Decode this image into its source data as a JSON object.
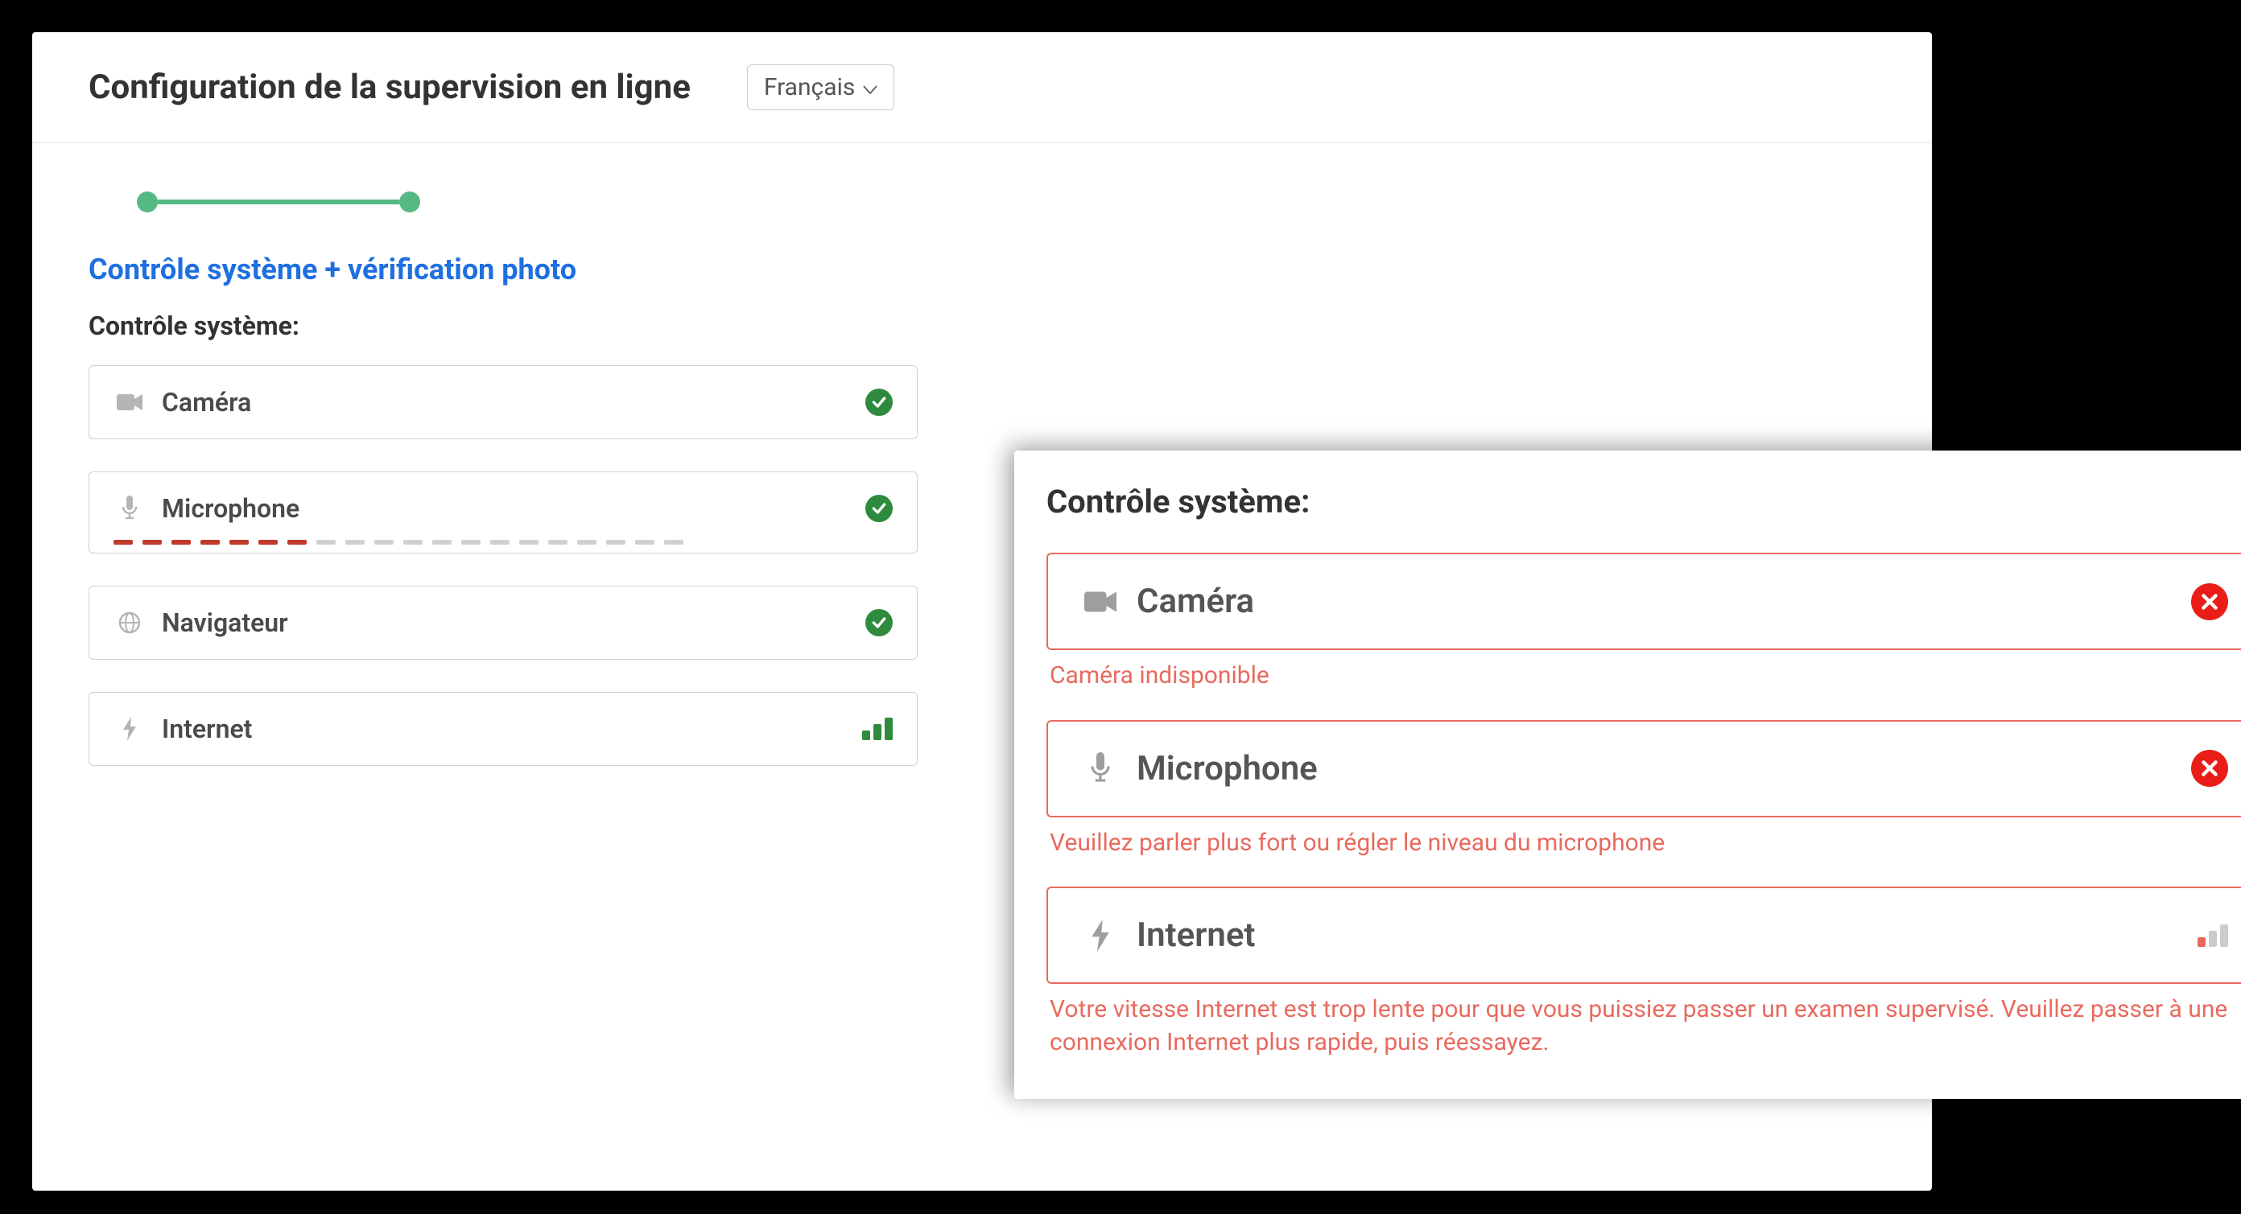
{
  "header": {
    "title": "Configuration de la supervision en ligne",
    "language": "Français"
  },
  "step_title": "Contrôle système + vérification photo",
  "section_label": "Contrôle système:",
  "left_checks": {
    "camera": {
      "label": "Caméra",
      "status": "ok"
    },
    "microphone": {
      "label": "Microphone",
      "status": "ok",
      "level_active": 7,
      "level_total": 20
    },
    "browser": {
      "label": "Navigateur",
      "status": "ok"
    },
    "internet": {
      "label": "Internet",
      "bars": 3
    }
  },
  "right_checks": {
    "section_label": "Contrôle système:",
    "camera": {
      "label": "Caméra",
      "error": "Caméra indisponible"
    },
    "microphone": {
      "label": "Microphone",
      "error": "Veuillez parler plus fort ou régler le niveau du microphone"
    },
    "internet": {
      "label": "Internet",
      "error": "Votre vitesse Internet est trop lente pour que vous puissiez passer un examen supervisé. Veuillez passer à une connexion Internet plus rapide, puis réessayez."
    }
  }
}
